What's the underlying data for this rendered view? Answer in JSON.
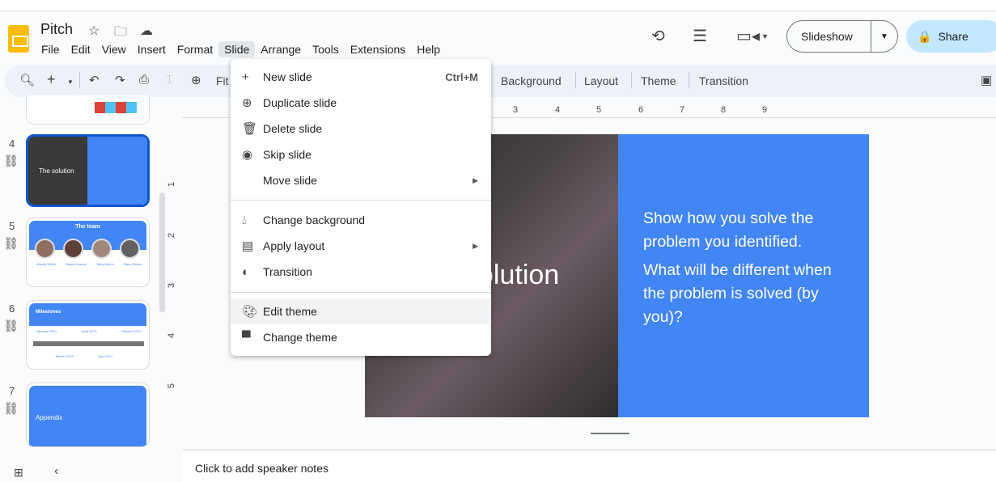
{
  "doc": {
    "title": "Pitch"
  },
  "menubar": [
    "File",
    "Edit",
    "View",
    "Insert",
    "Format",
    "Slide",
    "Arrange",
    "Tools",
    "Extensions",
    "Help"
  ],
  "header": {
    "slideshow_label": "Slideshow",
    "share_label": "Share"
  },
  "toolbar": {
    "fit_label": "Fit",
    "items": [
      "Background",
      "Layout",
      "Theme",
      "Transition"
    ]
  },
  "ruler": {
    "h": [
      "3",
      "4",
      "5",
      "6",
      "7",
      "8",
      "9"
    ],
    "v": [
      "1",
      "2",
      "3",
      "4",
      "5"
    ]
  },
  "filmstrip": [
    {
      "num": "4",
      "title": "The solution",
      "selected": true
    },
    {
      "num": "5",
      "title": "The team",
      "members": [
        "Wendy Writer",
        "Danny Dossier",
        "Abby Author",
        "Barry Books"
      ]
    },
    {
      "num": "6",
      "title": "Milestones",
      "events": [
        "January 20XX",
        "June 20XX",
        "October 20XX",
        "March 20XX",
        "July 20XX"
      ]
    },
    {
      "num": "7",
      "title": "Appendix"
    }
  ],
  "slide": {
    "title": "The solution",
    "title_visible": "olution",
    "p1": "Show how you solve the problem you identified.",
    "p2": "What will be different when the problem is solved (by you)?"
  },
  "notes": {
    "placeholder": "Click to add speaker notes"
  },
  "slide_menu": {
    "items": [
      {
        "icon": "plus-icon",
        "label": "New slide",
        "shortcut": "Ctrl+M"
      },
      {
        "icon": "duplicate-icon",
        "label": "Duplicate slide"
      },
      {
        "icon": "trash-icon",
        "label": "Delete slide"
      },
      {
        "icon": "eye-icon",
        "label": "Skip slide"
      },
      {
        "icon": "move-icon",
        "label": "Move slide",
        "submenu": true
      },
      {
        "icon": "background-icon",
        "label": "Change background"
      },
      {
        "icon": "layout-icon",
        "label": "Apply layout",
        "submenu": true
      },
      {
        "icon": "transition-icon",
        "label": "Transition"
      },
      {
        "icon": "palette-icon",
        "label": "Edit theme",
        "hovered": true
      },
      {
        "icon": "paint-roller-icon",
        "label": "Change theme"
      }
    ]
  },
  "colors": {
    "accent": "#4285f4",
    "selection": "#0b57d0",
    "share": "#c2e7ff"
  }
}
